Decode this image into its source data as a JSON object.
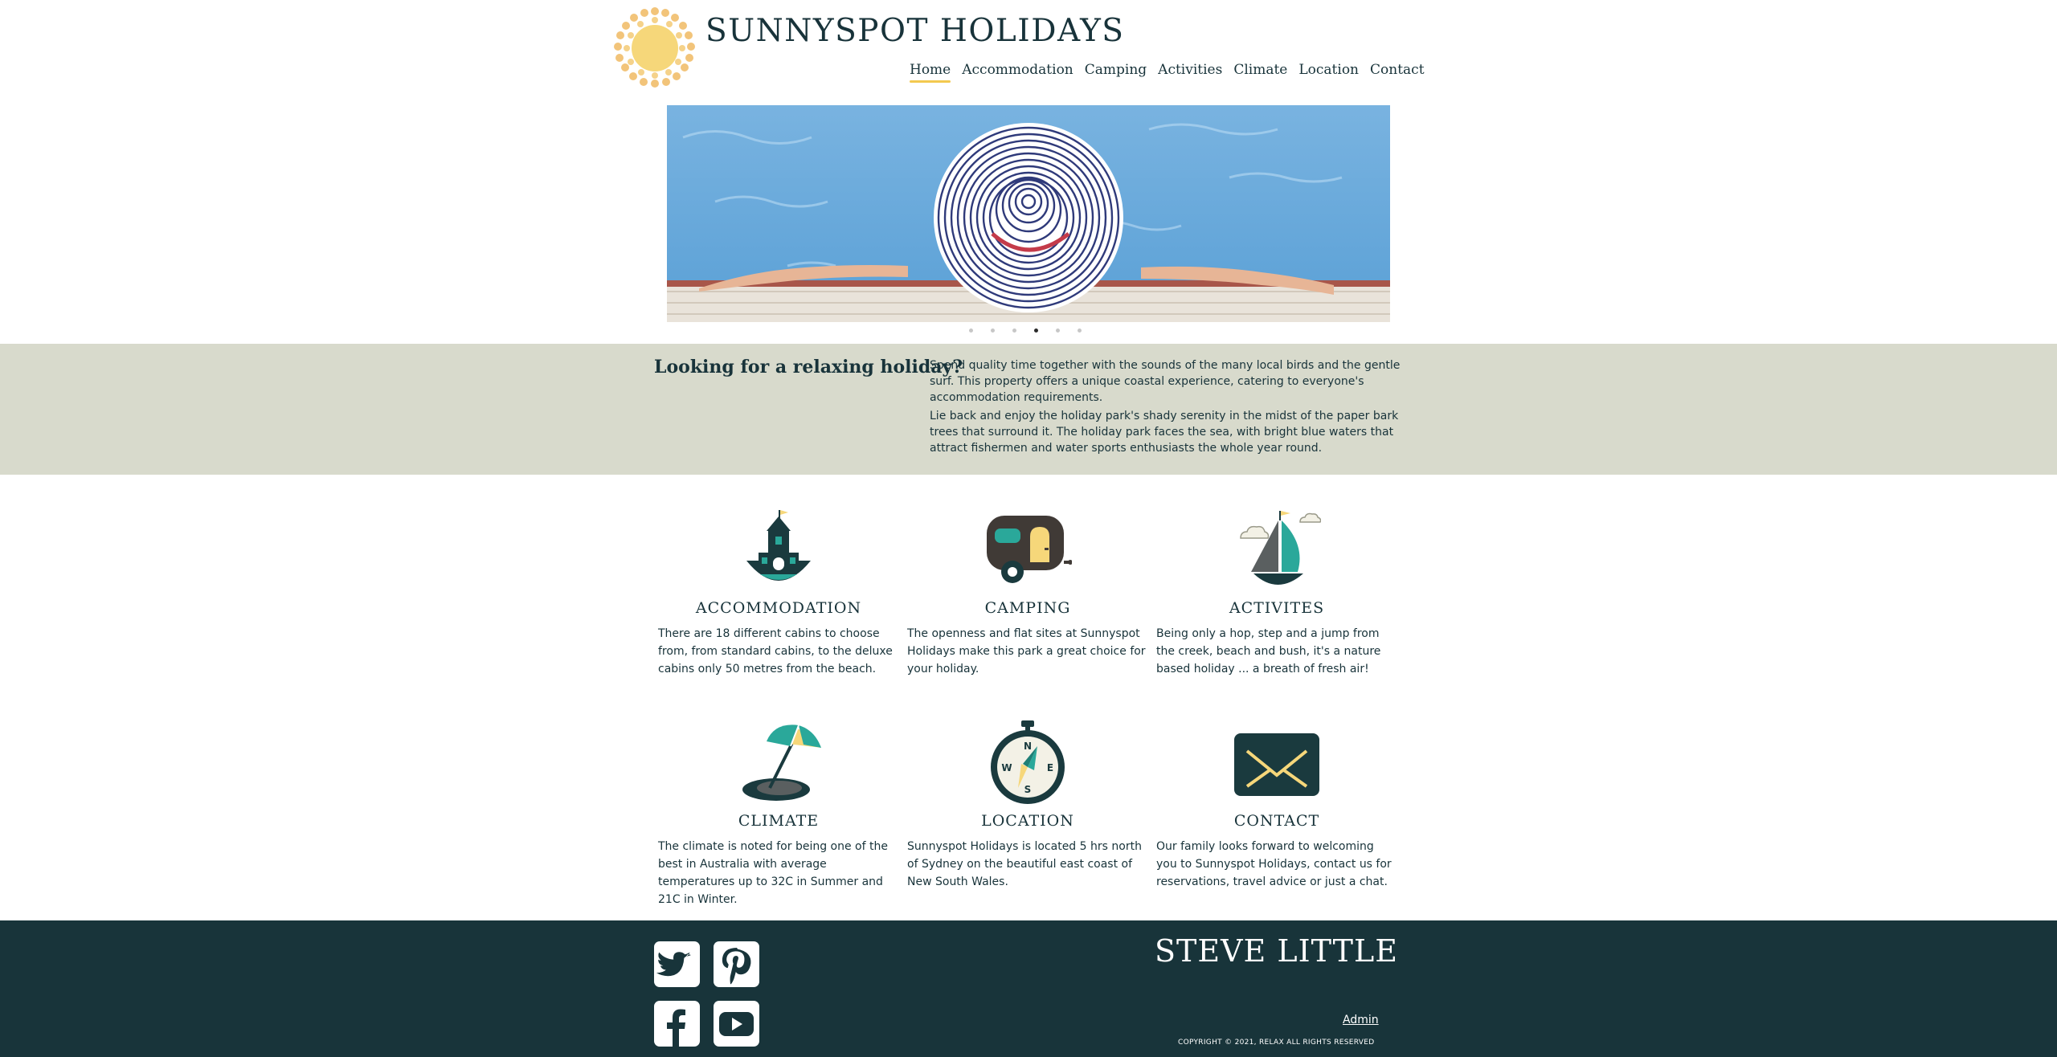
{
  "site": {
    "title": "SUNNYSPOT HOLIDAYS",
    "logo_icon": "sun-icon"
  },
  "nav": {
    "items": [
      {
        "label": "Home",
        "active": true
      },
      {
        "label": "Accommodation",
        "active": false
      },
      {
        "label": "Camping",
        "active": false
      },
      {
        "label": "Activities",
        "active": false
      },
      {
        "label": "Climate",
        "active": false
      },
      {
        "label": "Location",
        "active": false
      },
      {
        "label": "Contact",
        "active": false
      }
    ]
  },
  "hero": {
    "image": "woman-in-striped-hat-in-pool-photo",
    "slide_count": 6,
    "active_slide": 4
  },
  "intro": {
    "title": "Looking for a relaxing holiday?",
    "paragraphs": [
      "Spend quality time together with the sounds of the many local birds and the gentle surf. This property offers a unique coastal experience, catering to everyone's accommodation requirements.",
      "Lie back and enjoy the holiday park's shady serenity in the midst of the paper bark trees that surround it. The holiday park faces the sea, with bright blue waters that attract fishermen and water sports enthusiasts the whole year round."
    ]
  },
  "features": [
    {
      "title": "ACCOMMODATION",
      "icon": "castle-icon",
      "text": "There are 18 different cabins to choose from, from standard cabins, to the deluxe cabins only 50 metres from the beach."
    },
    {
      "title": "CAMPING",
      "icon": "caravan-icon",
      "text": "The openness and flat sites at Sunnyspot Holidays make this park a great choice for your holiday."
    },
    {
      "title": "ACTIVITES",
      "icon": "sailboat-icon",
      "text": "Being only a hop, step and a jump from the creek, beach and bush, it's a nature based holiday ... a breath of fresh air!"
    },
    {
      "title": "CLIMATE",
      "icon": "beach-umbrella-icon",
      "text": "The climate is noted for being one of the best in Australia with average temperatures up to 32C in Summer and 21C in Winter."
    },
    {
      "title": "LOCATION",
      "icon": "compass-icon",
      "text": "Sunnyspot Holidays is located 5 hrs north of Sydney on the beautiful east coast of New South Wales."
    },
    {
      "title": "CONTACT",
      "icon": "envelope-icon",
      "text": "Our family looks forward to welcoming you to Sunnyspot Holidays, contact us for reservations, travel advice or just a chat."
    }
  ],
  "footer": {
    "name": "STEVE LITTLE",
    "admin_label": "Admin",
    "copyright": "COPYRIGHT © 2021, RELAX ALL RIGHTS RESERVED",
    "social": [
      "twitter-icon",
      "pinterest-icon",
      "facebook-icon",
      "youtube-icon"
    ]
  },
  "colors": {
    "primary": "#18333a",
    "accent_yellow": "#f3c94f",
    "accent_teal": "#2aa89a",
    "intro_bg": "#d8dacc",
    "footer_bg": "#18343a"
  }
}
